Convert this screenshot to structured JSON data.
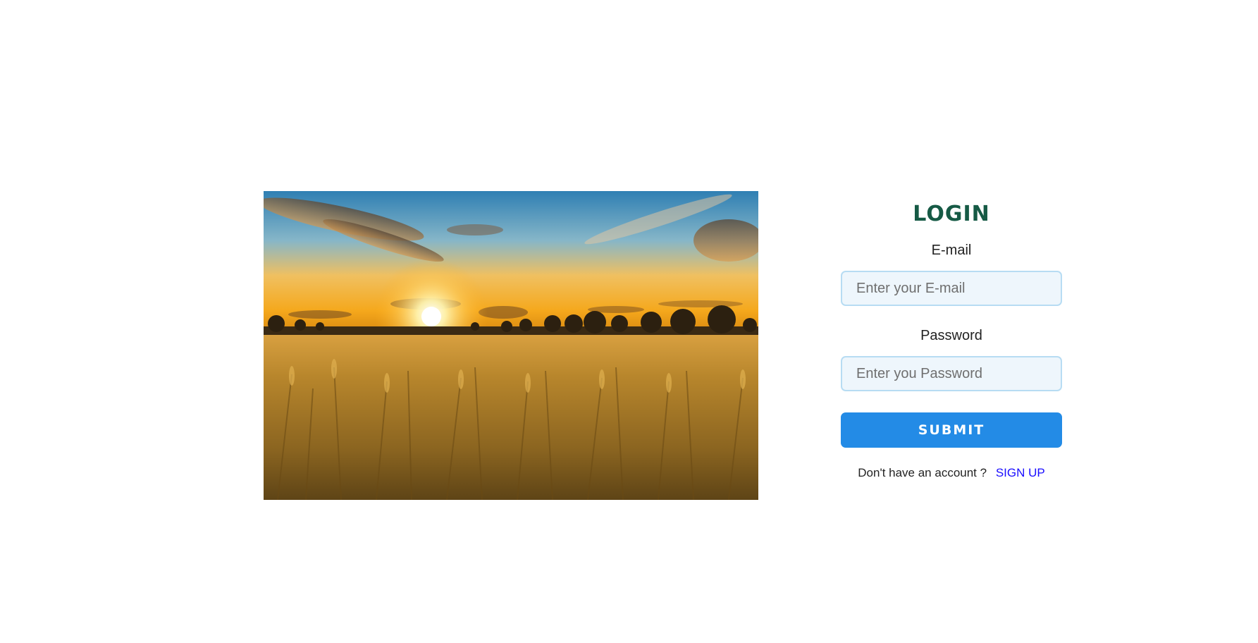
{
  "hero": {
    "image": "wheat field at sunset",
    "colors": {
      "sky_top": "#2f7fb3",
      "sky_mid": "#e9a93a",
      "sun": "#fff4b0",
      "field": "#9a7322"
    }
  },
  "login": {
    "title": "LOGIN",
    "email_label": "E-mail",
    "email_placeholder": "Enter your E-mail",
    "email_value": "",
    "password_label": "Password",
    "password_placeholder": "Enter you Password",
    "password_value": "",
    "submit_label": "SUBMIT",
    "signup_prompt": "Don't have an account ?",
    "signup_link": "SIGN UP",
    "colors": {
      "title": "#165a45",
      "submit_bg": "#238be6",
      "input_bg": "#eef6fc",
      "input_border": "#b7dcf3",
      "link": "#1a0dff"
    }
  }
}
